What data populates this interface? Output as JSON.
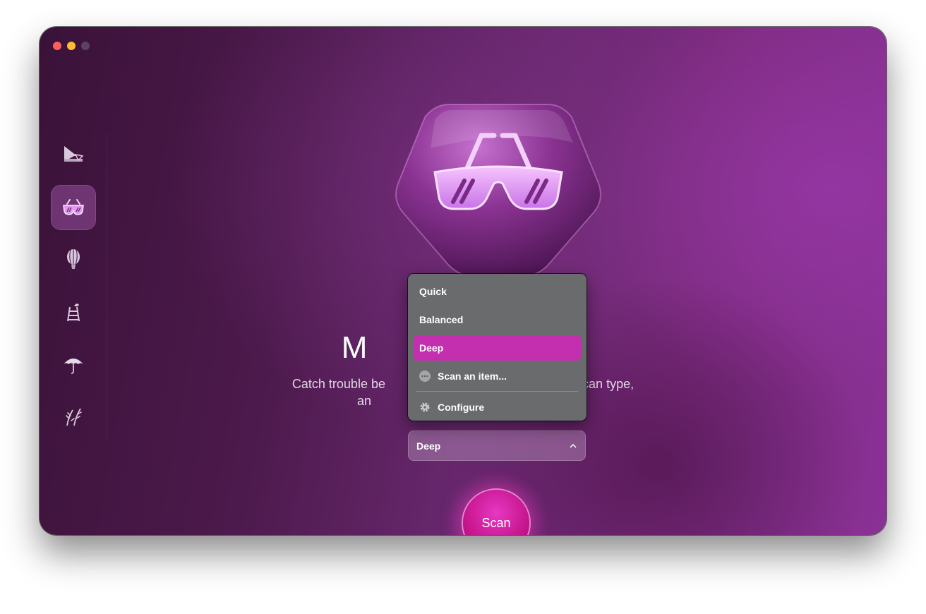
{
  "window": {
    "controls": [
      "close",
      "minimize",
      "maximize"
    ]
  },
  "sidebar": {
    "items": [
      {
        "name": "cleanup-icon",
        "active": false
      },
      {
        "name": "protection-icon",
        "active": true
      },
      {
        "name": "performance-icon",
        "active": false
      },
      {
        "name": "applications-icon",
        "active": false
      },
      {
        "name": "umbrella-icon",
        "active": false
      },
      {
        "name": "clutter-icon",
        "active": false
      }
    ]
  },
  "main": {
    "title": "M                     er",
    "subtitle_line1": "Catch trouble be                                           e your scan type,",
    "subtitle_line2": "an                                                   ed."
  },
  "scan_type": {
    "selected": "Deep",
    "menu": {
      "items": [
        "Quick",
        "Balanced",
        "Deep"
      ],
      "scan_item": "Scan an item...",
      "configure": "Configure"
    }
  },
  "scan_button": {
    "label": "Scan"
  },
  "colors": {
    "accent": "#c42fb0",
    "menu_bg": "#696b6d",
    "close": "#ff5f57",
    "minimize": "#febc2e"
  }
}
